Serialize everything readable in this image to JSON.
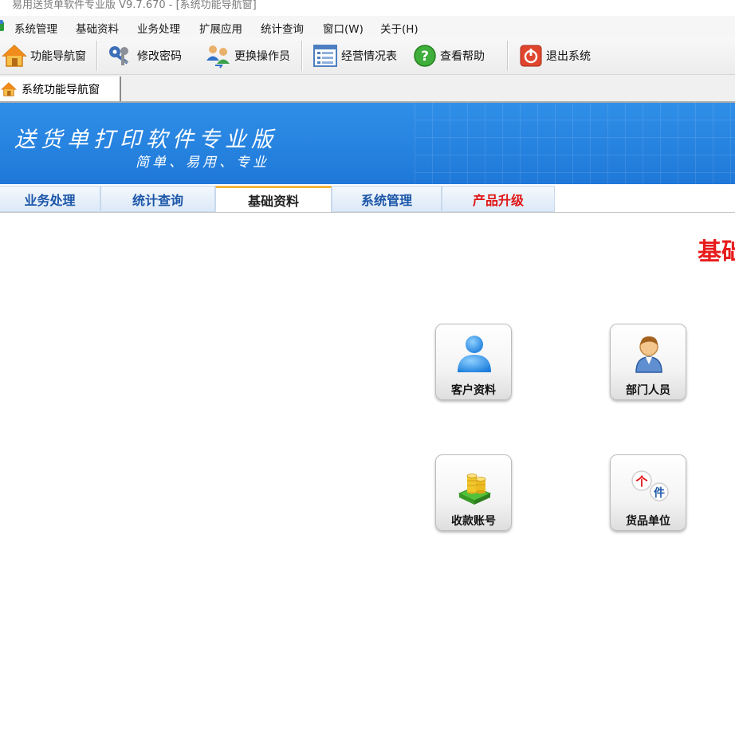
{
  "window": {
    "title": "易用送货单软件专业版 V9.7.670 - [系统功能导航窗]"
  },
  "menu": {
    "items": [
      "系统管理",
      "基础资料",
      "业务处理",
      "扩展应用",
      "统计查询",
      "窗口(W)",
      "关于(H)"
    ]
  },
  "toolbar": {
    "items": [
      {
        "label": "功能导航窗",
        "icon": "home-icon"
      },
      {
        "label": "修改密码",
        "icon": "keys-icon"
      },
      {
        "label": "更换操作员",
        "icon": "users-switch-icon"
      },
      {
        "label": "经营情况表",
        "icon": "report-list-icon"
      },
      {
        "label": "查看帮助",
        "icon": "help-icon"
      },
      {
        "label": "退出系统",
        "icon": "power-icon"
      }
    ]
  },
  "doc_tab": {
    "label": "系统功能导航窗",
    "icon": "home-icon"
  },
  "banner": {
    "title": "送货单打印软件专业版",
    "subtitle": "简单、易用、专业"
  },
  "nav_tabs": [
    {
      "label": "业务处理",
      "active": false
    },
    {
      "label": "统计查询",
      "active": false
    },
    {
      "label": "基础资料",
      "active": true
    },
    {
      "label": "系统管理",
      "active": false
    },
    {
      "label": "产品升级",
      "active": false,
      "color": "#e01515"
    }
  ],
  "section": {
    "title": "基础"
  },
  "tiles": [
    {
      "label": "客户资料",
      "icon": "customer-icon"
    },
    {
      "label": "部门人员",
      "icon": "staff-person-icon"
    },
    {
      "label": "收款账号",
      "icon": "coins-stack-icon"
    },
    {
      "label": "货品单位",
      "icon": "unit-icon",
      "glyphs": [
        "个",
        "件"
      ]
    }
  ],
  "colors": {
    "banner_blue": "#1f78d8",
    "section_red": "#e81c1c",
    "active_tab_accent": "#f2b53b",
    "tab_text_blue": "#1c56a8"
  }
}
